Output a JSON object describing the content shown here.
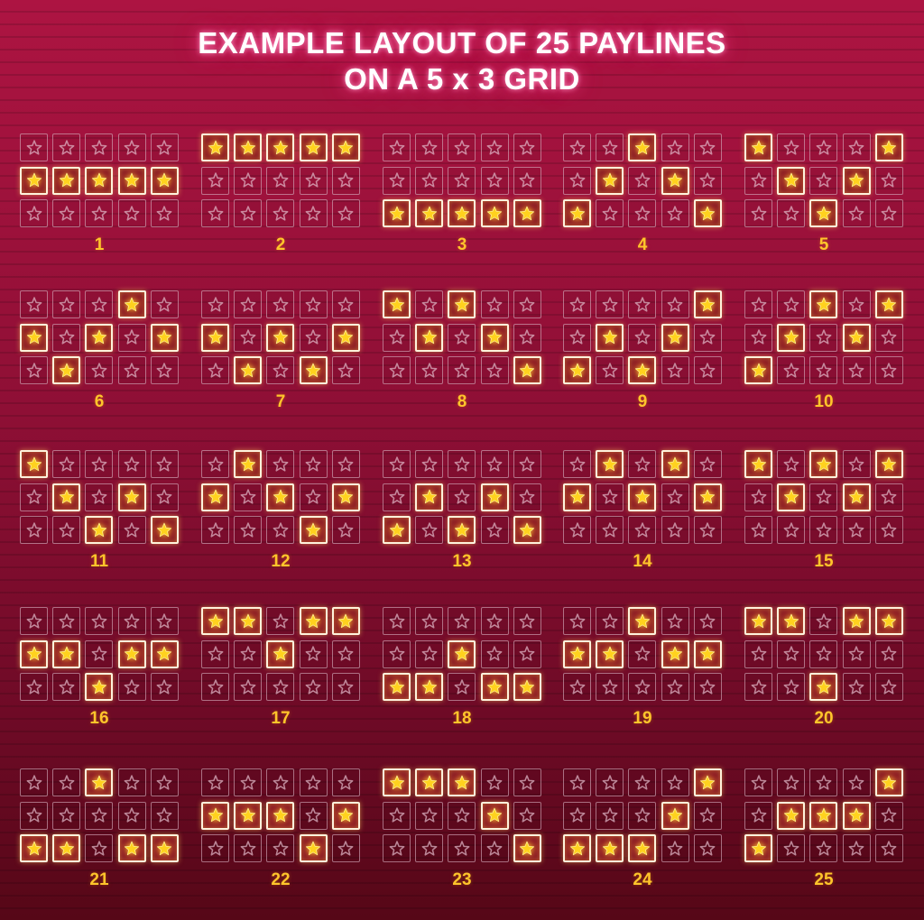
{
  "title": {
    "line1": "EXAMPLE LAYOUT OF 25 PAYLINES",
    "line2": "ON A 5 x 3 GRID"
  },
  "grid_spec": {
    "columns": 5,
    "rows": 3
  },
  "star_icon": "star-icon",
  "colors": {
    "background_top": "#ad1442",
    "background_bottom": "#560717",
    "number_text": "#ffc52b",
    "star_fill": "#ffd21e",
    "title_text": "#ffffff"
  },
  "paylines": [
    {
      "label": "1",
      "rows": [
        1,
        1,
        1,
        1,
        1
      ]
    },
    {
      "label": "2",
      "rows": [
        0,
        0,
        0,
        0,
        0
      ]
    },
    {
      "label": "3",
      "rows": [
        2,
        2,
        2,
        2,
        2
      ]
    },
    {
      "label": "4",
      "rows": [
        2,
        1,
        0,
        1,
        2
      ]
    },
    {
      "label": "5",
      "rows": [
        0,
        1,
        2,
        1,
        0
      ]
    },
    {
      "label": "6",
      "rows": [
        1,
        2,
        1,
        0,
        1
      ]
    },
    {
      "label": "7",
      "rows": [
        1,
        2,
        1,
        2,
        1
      ]
    },
    {
      "label": "8",
      "rows": [
        0,
        1,
        0,
        1,
        2
      ]
    },
    {
      "label": "9",
      "rows": [
        2,
        1,
        2,
        1,
        0
      ]
    },
    {
      "label": "10",
      "rows": [
        2,
        1,
        0,
        1,
        0
      ]
    },
    {
      "label": "11",
      "rows": [
        0,
        1,
        2,
        1,
        2
      ]
    },
    {
      "label": "12",
      "rows": [
        1,
        0,
        1,
        2,
        1
      ]
    },
    {
      "label": "13",
      "rows": [
        2,
        1,
        2,
        1,
        2
      ]
    },
    {
      "label": "14",
      "rows": [
        1,
        0,
        1,
        0,
        1
      ]
    },
    {
      "label": "15",
      "rows": [
        0,
        1,
        0,
        1,
        0
      ]
    },
    {
      "label": "16",
      "rows": [
        1,
        1,
        2,
        1,
        1
      ]
    },
    {
      "label": "17",
      "rows": [
        0,
        0,
        1,
        0,
        0
      ]
    },
    {
      "label": "18",
      "rows": [
        2,
        2,
        1,
        2,
        2
      ]
    },
    {
      "label": "19",
      "rows": [
        1,
        1,
        0,
        1,
        1
      ]
    },
    {
      "label": "20",
      "rows": [
        0,
        0,
        2,
        0,
        0
      ]
    },
    {
      "label": "21",
      "rows": [
        2,
        2,
        0,
        2,
        2
      ]
    },
    {
      "label": "22",
      "rows": [
        1,
        1,
        1,
        2,
        1
      ]
    },
    {
      "label": "23",
      "rows": [
        0,
        0,
        0,
        1,
        2
      ]
    },
    {
      "label": "24",
      "rows": [
        2,
        2,
        2,
        1,
        0
      ]
    },
    {
      "label": "25",
      "rows": [
        2,
        1,
        1,
        1,
        0
      ]
    }
  ]
}
